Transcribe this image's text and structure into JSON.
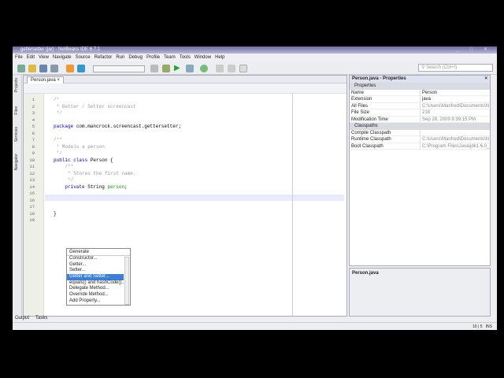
{
  "title": "gettersetter (jar) - NetBeans IDE 6.7.1",
  "menu": [
    "File",
    "Edit",
    "View",
    "Navigate",
    "Source",
    "Refactor",
    "Run",
    "Debug",
    "Profile",
    "Team",
    "Tools",
    "Window",
    "Help"
  ],
  "search_placeholder": "Search (Ctrl+I)",
  "side_tabs": [
    "Projects",
    "Files",
    "Services",
    "Navigator"
  ],
  "editor": {
    "tab": "Person.java",
    "lines": [
      {
        "n": "1",
        "t": "/*",
        "c": "cm"
      },
      {
        "n": "2",
        "t": " * Getter / Setter screencast",
        "c": "cm"
      },
      {
        "n": "3",
        "t": " */",
        "c": "cm"
      },
      {
        "n": "4",
        "t": "",
        "c": ""
      },
      {
        "n": "5",
        "t": "package com.mancrock.screencast.gettersetter;",
        "c": ""
      },
      {
        "n": "6",
        "t": "",
        "c": ""
      },
      {
        "n": "7",
        "t": "/**",
        "c": "cm"
      },
      {
        "n": "8",
        "t": " * Models a person",
        "c": "cm"
      },
      {
        "n": "9",
        "t": " */",
        "c": "cm"
      },
      {
        "n": "10",
        "t": "public class Person {",
        "c": ""
      },
      {
        "n": "11",
        "t": "    /**",
        "c": "cm"
      },
      {
        "n": "12",
        "t": "     * Stores the first name.",
        "c": "cm"
      },
      {
        "n": "13",
        "t": "     */",
        "c": "cm"
      },
      {
        "n": "14",
        "t": "    private String person;",
        "c": ""
      },
      {
        "n": "15",
        "t": "",
        "c": ""
      },
      {
        "n": "16",
        "t": "",
        "c": ""
      },
      {
        "n": "17",
        "t": "",
        "c": ""
      },
      {
        "n": "18",
        "t": "}",
        "c": ""
      },
      {
        "n": "19",
        "t": "",
        "c": ""
      }
    ]
  },
  "popup": {
    "header": "Generate",
    "items": [
      "Constructor...",
      "Getter...",
      "Setter...",
      "Getter and Setter...",
      "equals() and hashCode()...",
      "Delegate Method...",
      "Override Method...",
      "Add Property..."
    ],
    "selected": 3
  },
  "properties": {
    "title": "Person.java - Properties",
    "sections": [
      {
        "name": "Properties",
        "rows": [
          [
            "Name",
            "Person"
          ],
          [
            "Extension",
            "java"
          ],
          [
            "All Files",
            "C:\\Users\\Manfred\\Documents\\N"
          ],
          [
            "File Size",
            "218"
          ],
          [
            "Modification Time",
            "Sep 28, 2009 9:39:15 PM"
          ]
        ]
      },
      {
        "name": "Classpaths",
        "rows": [
          [
            "Compile Classpath",
            ""
          ],
          [
            "Runtime Classpath",
            "C:\\Users\\Manfred\\Documents\\N"
          ],
          [
            "Boot Classpath",
            "C:\\Program Files\\Java\\jdk1.6.0_1"
          ]
        ]
      }
    ],
    "description": "Person.java"
  },
  "bottom_tabs": [
    "Output",
    "Tasks"
  ],
  "status": {
    "position": "16 | 5",
    "mode": "INS"
  }
}
